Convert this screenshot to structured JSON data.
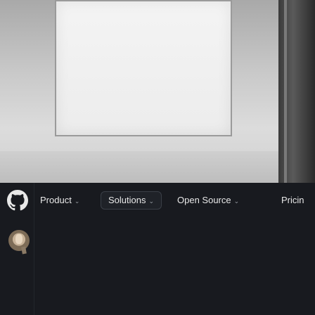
{
  "nav": {
    "logo_icon": "github-mark-icon",
    "items": [
      {
        "label": "Product",
        "icon": "chevron-down-icon"
      },
      {
        "label": "Solutions",
        "icon": "chevron-down-icon"
      },
      {
        "label": "Open Source",
        "icon": "chevron-down-icon"
      },
      {
        "label": "Pricin",
        "icon": ""
      }
    ]
  },
  "colors": {
    "nav_bg": "#181a1f",
    "nav_text": "#e8e8e8",
    "chevron": "#9aa0a6"
  },
  "avatar_icon": "octocat-avatar-icon"
}
